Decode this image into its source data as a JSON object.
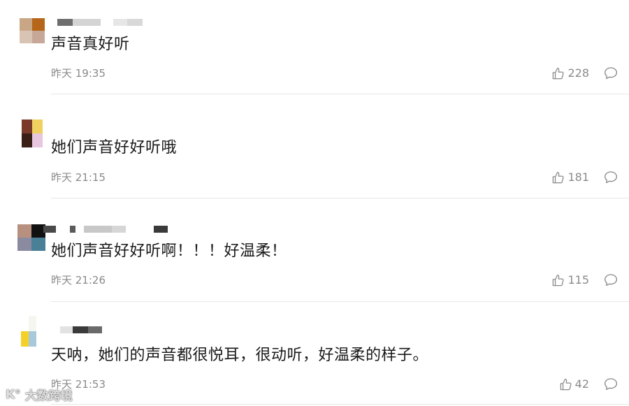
{
  "comments": [
    {
      "text": "声音真好听",
      "time": "昨天 19:35",
      "likes": "228",
      "avatar_colors": [
        "#c9a786",
        "#b5661b",
        "#d9c3b2",
        "#c7a898"
      ]
    },
    {
      "text": "她们声音好好听哦",
      "time": "昨天 21:15",
      "likes": "181",
      "avatar_colors": [
        "#7a3b2a",
        "#f0d060",
        "#3a1f17",
        "#e8c6e0"
      ]
    },
    {
      "text": "她们声音好好听啊！！！好温柔！",
      "time": "昨天 21:26",
      "likes": "115",
      "avatar_colors": [
        "#b89080",
        "#111111",
        "#8a8aa0",
        "#4a7f98"
      ]
    },
    {
      "text": "天呐，她们的声音都很悦耳，很动听，好温柔的样子。",
      "time": "昨天 21:53",
      "likes": "42",
      "avatar_colors": [
        "#ffffff",
        "#f6f6f0",
        "#f4d12a",
        "#a8c8dc"
      ]
    }
  ],
  "watermark": {
    "logo_text": "K°",
    "text": "大数跨境"
  },
  "colors": {
    "text": "#1a1a1a",
    "meta": "#8a8a8a",
    "divider": "#e6e6e6"
  }
}
